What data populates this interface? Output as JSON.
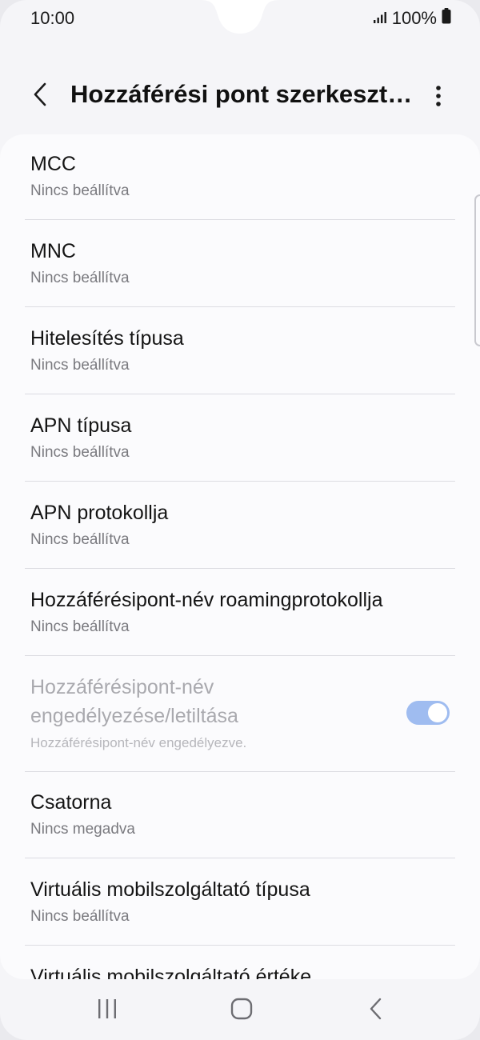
{
  "status_bar": {
    "time": "10:00",
    "battery": "100%",
    "signal_icon": "signal-icon",
    "battery_icon": "battery-icon"
  },
  "app_bar": {
    "title": "Hozzáférési pont szerkesztése",
    "back_icon": "chevron-left-icon",
    "more_icon": "more-vertical-icon"
  },
  "settings": [
    {
      "title": "MCC",
      "subtitle": "Nincs beállítva"
    },
    {
      "title": "MNC",
      "subtitle": "Nincs beállítva"
    },
    {
      "title": "Hitelesítés típusa",
      "subtitle": "Nincs beállítva"
    },
    {
      "title": "APN típusa",
      "subtitle": "Nincs beállítva"
    },
    {
      "title": "APN protokollja",
      "subtitle": "Nincs beállítva"
    },
    {
      "title": "Hozzáférésipont-név roamingprotokollja",
      "subtitle": "Nincs beállítva"
    },
    {
      "title_line1": "Hozzáférésipont-név",
      "title_line2": "engedélyezése/letiltása",
      "subtitle": "Hozzáférésipont-név engedélyezve.",
      "toggle_on": true
    },
    {
      "title": "Csatorna",
      "subtitle": "Nincs megadva"
    },
    {
      "title": "Virtuális mobilszolgáltató típusa",
      "subtitle": "Nincs beállítva"
    },
    {
      "title": "Virtuális mobilszolgáltató értéke",
      "subtitle": ""
    }
  ],
  "nav_bar": {
    "recents_icon": "recents-icon",
    "home_icon": "home-icon",
    "back_icon": "back-icon"
  },
  "colors": {
    "toggle_on": "#9fbcf0",
    "background": "#f5f5f8",
    "card": "#fbfbfd"
  }
}
